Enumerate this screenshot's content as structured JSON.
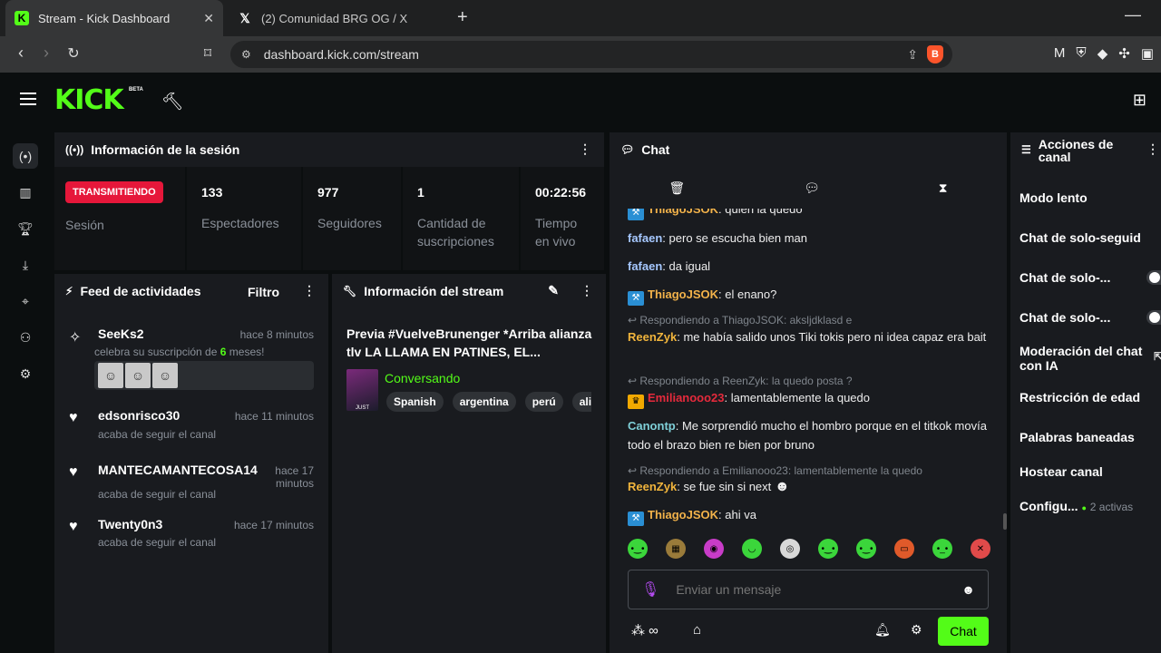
{
  "browser": {
    "tabs": [
      {
        "title": "Stream - Kick Dashboard",
        "icon": "kick-favicon"
      },
      {
        "title": "(2) Comunidad BRG OG / X",
        "icon": "x-favicon"
      }
    ],
    "url": "dashboard.kick.com/stream"
  },
  "header": {
    "logo": "KICK",
    "beta": "BETA"
  },
  "session": {
    "title": "Información de la sesión",
    "live_badge": "TRANSMITIENDO",
    "session_label": "Sesión",
    "stats": [
      {
        "value": "133",
        "label": "Espectadores"
      },
      {
        "value": "977",
        "label": "Seguidores"
      },
      {
        "value": "1",
        "label": "Cantidad de suscripciones"
      },
      {
        "value": "00:22:56",
        "label": "Tiempo en vivo"
      }
    ]
  },
  "feed": {
    "title": "Feed de actividades",
    "filter": "Filtro",
    "items": [
      {
        "name": "SeeKs2",
        "time": "hace 8 minutos",
        "desc_pre": "celebra su suscripción de ",
        "desc_num": "6",
        "desc_post": " meses!"
      },
      {
        "name": "edsonrisco30",
        "time": "hace 11 minutos",
        "desc": "acaba de seguir el canal"
      },
      {
        "name": "MANTECAMANTECOSA14",
        "time": "hace 17 minutos",
        "desc": "acaba de seguir el canal"
      },
      {
        "name": "Twenty0n3",
        "time": "hace 17 minutos",
        "desc": "acaba de seguir el canal"
      }
    ]
  },
  "stream_info": {
    "title_label": "Información del stream",
    "stream_title": "Previa #VuelveBrunenger *Arriba alianza tlv LA LLAMA EN PATINES, EL...",
    "category": "Conversando",
    "tags": [
      "Spanish",
      "argentina",
      "perú",
      "alia"
    ]
  },
  "chat": {
    "title": "Chat",
    "messages": [
      {
        "type": "msg",
        "user": "ThiagoJSOK",
        "color": "#f2b24a",
        "badge": "hammer",
        "text": "quien la quedo"
      },
      {
        "type": "msg",
        "user": "fafaen",
        "color": "#a6c8ff",
        "text": "pero se escucha bien man"
      },
      {
        "type": "msg",
        "user": "fafaen",
        "color": "#a6c8ff",
        "text": "da igual"
      },
      {
        "type": "msg",
        "user": "ThiagoJSOK",
        "color": "#f2b24a",
        "badge": "hammer",
        "text": "el enano?"
      },
      {
        "type": "reply",
        "text": "Respondiendo a ThiagoJSOK: aksljdklasd e"
      },
      {
        "type": "msg",
        "user": "ReenZyk",
        "color": "#f0b43c",
        "text": "me había salido unos Tiki tokis pero ni idea capaz era bait"
      },
      {
        "type": "reply",
        "text": "Respondiendo a ReenZyk: la quedo posta ?"
      },
      {
        "type": "msg",
        "user": "Emilianooo23",
        "color": "#e62a3c",
        "badge": "crown",
        "text": "lamentablemente la quedo"
      },
      {
        "type": "msg",
        "user": "Canontp",
        "color": "#7fd0d8",
        "text": "Me sorprendió mucho el hombro porque en el titkok movía todo el brazo bien re bien por bruno"
      },
      {
        "type": "reply",
        "text": "Respondiendo a Emilianooo23: lamentablemente la quedo"
      },
      {
        "type": "msg",
        "user": "ReenZyk",
        "color": "#f0b43c",
        "text": "se fue sin si next"
      },
      {
        "type": "msg",
        "user": "ThiagoJSOK",
        "color": "#f2b24a",
        "badge": "hammer",
        "text": "ahi va"
      }
    ],
    "placeholder": "Enviar un mensaje",
    "send_label": "Chat"
  },
  "actions": {
    "title": "Acciones de canal",
    "items": [
      {
        "label": "Modo lento",
        "control": "arrow"
      },
      {
        "label": "Chat de solo-seguid",
        "control": "arrow"
      },
      {
        "label": "Chat de solo-...",
        "control": "toggle"
      },
      {
        "label": "Chat de solo-...",
        "control": "toggle"
      },
      {
        "label": "Moderación del chat con IA",
        "control": "external"
      },
      {
        "label": "Restricción de edad",
        "control": "arrow"
      },
      {
        "label": "Palabras baneadas",
        "control": "arrow"
      },
      {
        "label": "Hostear canal",
        "control": "none"
      },
      {
        "label": "Configu...",
        "control": "arrow",
        "sub": "2 activas"
      }
    ]
  },
  "colors": {
    "accent": "#53fc18",
    "live": "#e6173a",
    "panel": "#191b1f",
    "background": "#0b0e0f"
  }
}
